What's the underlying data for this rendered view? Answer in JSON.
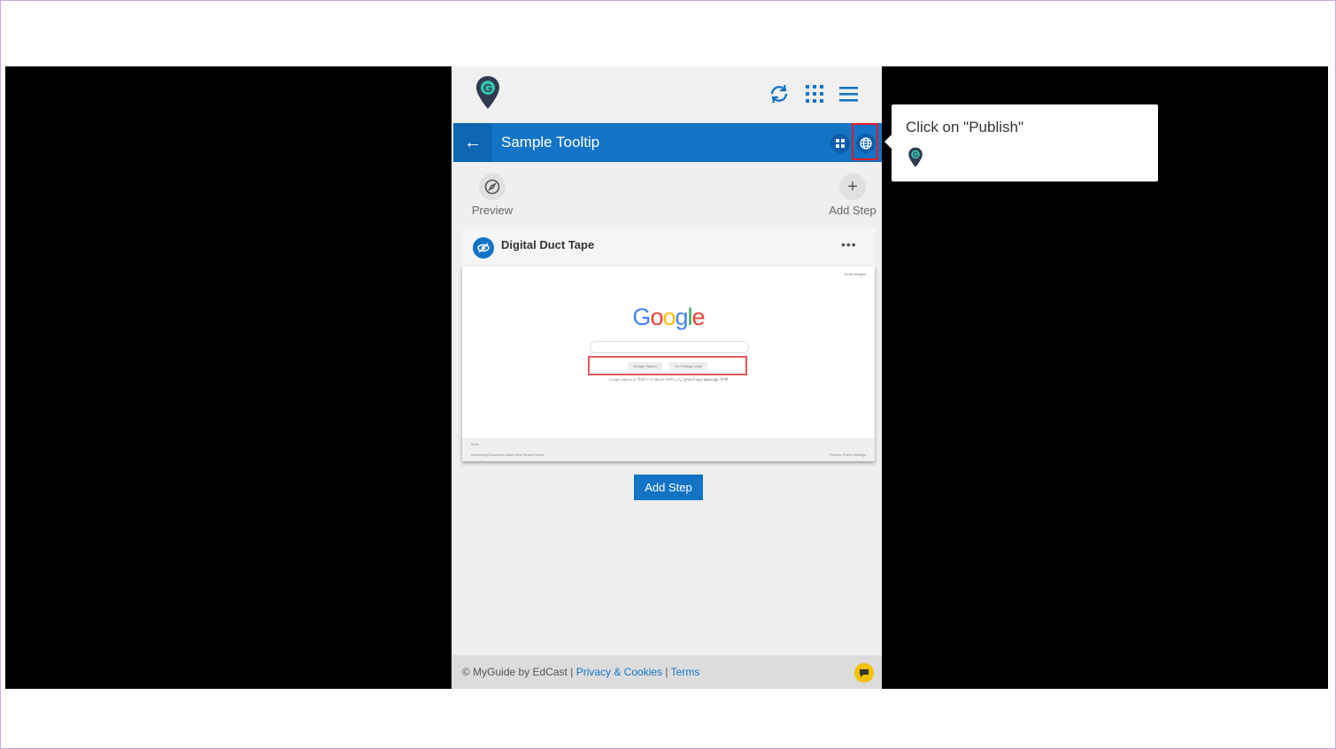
{
  "panel": {
    "header_title": "Sample Tooltip",
    "back_glyph": "←",
    "toolbar": {
      "preview_label": "Preview",
      "add_step_label": "Add Step"
    },
    "step_card": {
      "title": "Digital Duct Tape",
      "more_glyph": "•••"
    },
    "screenshot": {
      "brand": "Google",
      "btn_search": "Google Search",
      "btn_lucky": "I'm Feeling Lucky",
      "top_links": "Gmail   Images",
      "lang_line": "Google offered in:  हिन्दी  বাংলা  తెలుగు  मराठी  தமிழ்  ગુજરાતી  ಕನ್ನಡ  മലയാളം  ਪੰਜਾਬੀ",
      "footer_left": "India",
      "footer_links": "Advertising   Business   About   How Search works",
      "footer_right": "Privacy   Terms   Settings"
    },
    "add_step_button": "Add Step",
    "footer": {
      "copyright": "© MyGuide by EdCast",
      "sep": "|",
      "privacy": "Privacy & Cookies",
      "terms": "Terms"
    }
  },
  "tooltip": {
    "text": "Click on \"Publish\""
  },
  "colors": {
    "primary_blue": "#1374c6",
    "highlight_red": "#e01e24",
    "chat_yellow": "#f2c200"
  },
  "icons": [
    "myguide-logo-icon",
    "sync-icon",
    "apps-grid-icon",
    "menu-icon",
    "arrow-left-icon",
    "widget-icon",
    "globe-icon",
    "compass-icon",
    "plus-icon",
    "hidden-eye-icon",
    "chat-icon"
  ]
}
